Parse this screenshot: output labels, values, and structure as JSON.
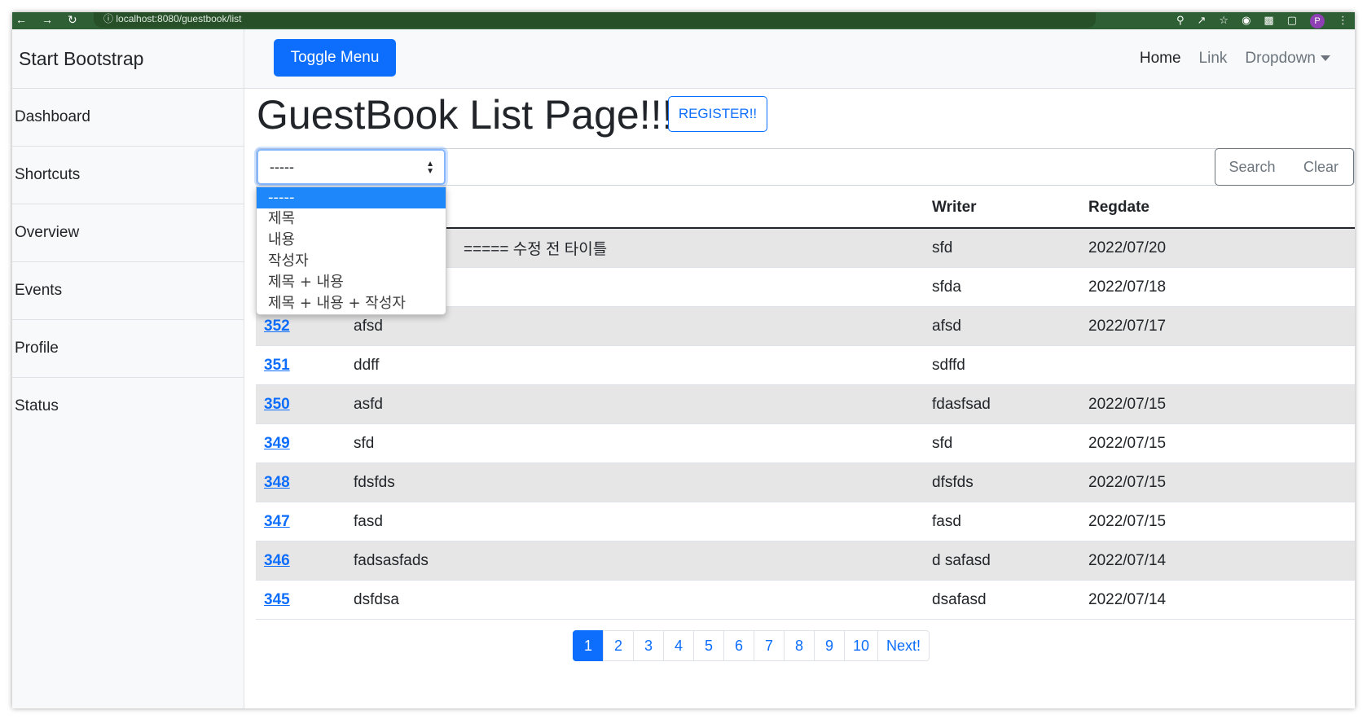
{
  "browser": {
    "url": "localhost:8080/guestbook/list",
    "profile_initial": "P"
  },
  "sidebar": {
    "brand": "Start Bootstrap",
    "items": [
      {
        "label": "Dashboard"
      },
      {
        "label": "Shortcuts"
      },
      {
        "label": "Overview"
      },
      {
        "label": "Events"
      },
      {
        "label": "Profile"
      },
      {
        "label": "Status"
      }
    ]
  },
  "topbar": {
    "toggle_label": "Toggle Menu",
    "nav": {
      "home": "Home",
      "link": "Link",
      "dropdown": "Dropdown"
    }
  },
  "main": {
    "title": "GuestBook List Page!!!!",
    "register_label": "REGISTER!!"
  },
  "search": {
    "selected": "-----",
    "options": [
      "-----",
      "제목",
      "내용",
      "작성자",
      "제목 + 내용",
      "제목 + 내용 + 작성자"
    ],
    "keyword": "",
    "search_label": "Search",
    "clear_label": "Clear"
  },
  "table": {
    "headers": {
      "gno": "",
      "title": "",
      "writer": "Writer",
      "regdate": "Regdate"
    },
    "rows": [
      {
        "gno": "",
        "title": "===== 수정 전 타이틀",
        "writer": "sfd",
        "regdate": "2022/07/20"
      },
      {
        "gno": "",
        "title": "",
        "writer": "sfda",
        "regdate": "2022/07/18"
      },
      {
        "gno": "352",
        "title": "afsd",
        "writer": "afsd",
        "regdate": "2022/07/17"
      },
      {
        "gno": "351",
        "title": "ddff",
        "writer": "sdffd",
        "regdate": ""
      },
      {
        "gno": "350",
        "title": "asfd",
        "writer": "fdasfsad",
        "regdate": "2022/07/15"
      },
      {
        "gno": "349",
        "title": "sfd",
        "writer": "sfd",
        "regdate": "2022/07/15"
      },
      {
        "gno": "348",
        "title": "fdsfds",
        "writer": "dfsfds",
        "regdate": "2022/07/15"
      },
      {
        "gno": "347",
        "title": "fasd",
        "writer": "fasd",
        "regdate": "2022/07/15"
      },
      {
        "gno": "346",
        "title": "fadsasfads",
        "writer": "d safasd",
        "regdate": "2022/07/14"
      },
      {
        "gno": "345",
        "title": "dsfdsa",
        "writer": "dsafasd",
        "regdate": "2022/07/14"
      }
    ]
  },
  "pagination": {
    "pages": [
      "1",
      "2",
      "3",
      "4",
      "5",
      "6",
      "7",
      "8",
      "9",
      "10"
    ],
    "active": "1",
    "next_label": "Next!"
  },
  "colors": {
    "primary": "#0d6efd",
    "chrome": "#2f5f34",
    "stripe": "#e6e6e6",
    "dropdown_highlight": "#1e88fb"
  }
}
